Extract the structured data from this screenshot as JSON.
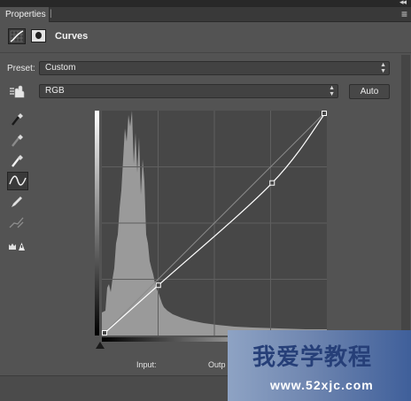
{
  "header": {
    "tab_label": "Properties",
    "panel_title": "Curves"
  },
  "preset": {
    "label": "Preset:",
    "value": "Custom"
  },
  "channel": {
    "value": "RGB",
    "auto_label": "Auto"
  },
  "tools": [
    {
      "name": "on-image-adjust-icon"
    },
    {
      "name": "black-point-eyedropper-icon"
    },
    {
      "name": "gray-point-eyedropper-icon"
    },
    {
      "name": "white-point-eyedropper-icon"
    },
    {
      "name": "curve-edit-icon",
      "active": true
    },
    {
      "name": "pencil-draw-icon"
    },
    {
      "name": "smooth-curve-icon"
    },
    {
      "name": "clipping-warning-icon"
    }
  ],
  "curve": {
    "input_label": "Input:",
    "output_label": "Outp",
    "points": [
      [
        0,
        0
      ],
      [
        64,
        57
      ],
      [
        193,
        173
      ],
      [
        255,
        255
      ]
    ]
  },
  "watermark": {
    "main_text": "我爱学教程",
    "url_text": "www.52xjc.com"
  }
}
